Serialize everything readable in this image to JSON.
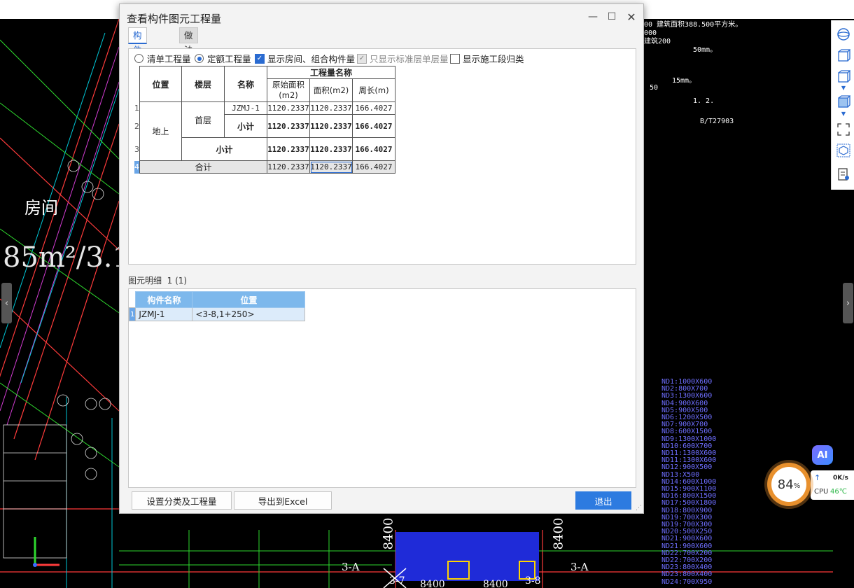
{
  "dialog": {
    "title": "查看构件图元工程量",
    "tabs": [
      {
        "label": "构件工程量",
        "active": true
      },
      {
        "label": "做法工程量",
        "active": false
      }
    ],
    "options": {
      "radio_list": "清单工程量",
      "radio_quota": "定额工程量",
      "radio_selected": "定额工程量",
      "show_rooms": {
        "label": "显示房间、组合构件量",
        "checked": true
      },
      "show_std_floor": {
        "label": "只显示标准层单层量",
        "checked": true,
        "disabled": true
      },
      "show_stage": {
        "label": "显示施工段归类",
        "checked": false
      }
    },
    "table": {
      "headers": {
        "position": "位置",
        "floor": "楼层",
        "name": "名称",
        "qty_group": "工程量名称",
        "orig_area": "原始面积(m2)",
        "area": "面积(m2)",
        "perimeter": "周长(m)"
      },
      "row_numbers": [
        "1",
        "2",
        "3",
        "4"
      ],
      "rows": {
        "position_value": "地上",
        "floor_value": "首层",
        "r1": {
          "name": "JZMJ-1",
          "orig_area": "1120.2337",
          "area": "1120.2337",
          "perimeter": "166.4027"
        },
        "r2": {
          "name": "小计",
          "orig_area": "1120.2337",
          "area": "1120.2337",
          "perimeter": "166.4027"
        },
        "r3": {
          "name": "小计",
          "orig_area": "1120.2337",
          "area": "1120.2337",
          "perimeter": "166.4027"
        },
        "r4": {
          "name": "合计",
          "orig_area": "1120.2337",
          "area": "1120.2337",
          "perimeter": "166.4027"
        }
      }
    },
    "detail": {
      "label": "图元明细",
      "count": "1 (1)",
      "headers": {
        "component": "构件名称",
        "position": "位置"
      },
      "rows": [
        {
          "n": "1",
          "component": "JZMJ-1",
          "position": "<3-8,1+250>"
        }
      ]
    },
    "buttons": {
      "classify": "设置分类及工程量",
      "export": "导出到Excel",
      "exit": "退出"
    }
  },
  "background": {
    "room_label": "房间",
    "area_text": "85m²/3.1",
    "dims": [
      "8400",
      "8400",
      "8400",
      "8400"
    ],
    "axis_labels": [
      "3-A",
      "3-A",
      "3-7",
      "3-8"
    ],
    "notes_top": "00 建筑面积388.500平方米。",
    "notes_2": "000",
    "notes_3": "建筑200",
    "notes_4": "50mm。",
    "notes_5": "15mm。",
    "notes_6": "50",
    "notes_7": "1. 2.",
    "notes_8": "B/T27903",
    "door_list": [
      "ND1:1000X600",
      "ND2:800X700",
      "ND3:1300X600",
      "ND4:900X600",
      "ND5:900X500",
      "ND6:1200X500",
      "ND7:900X700",
      "ND8:600X1500",
      "ND9:1300X1000",
      "ND10:600X700",
      "ND11:1300X600",
      "ND11:1300X600",
      "ND12:900X500",
      "ND13:X500",
      "ND14:600X1000",
      "ND15:900X1100",
      "ND16:800X1500",
      "ND17:500X1800",
      "ND18:800X900",
      "ND19:700X300",
      "ND19:700X300",
      "ND20:500X250",
      "ND21:900X600",
      "ND21:900X600",
      "ND22:700X200",
      "ND22:700X200",
      "ND23:800X400",
      "ND23:800X400",
      "ND24:700X950"
    ]
  },
  "right_toolbar": {
    "icons": [
      "globe-3d-icon",
      "view-3d-icon",
      "cube-outline-icon",
      "chevron-down-icon",
      "cube-solid-icon",
      "chevron-down-icon",
      "fullscreen-icon",
      "cube-select-icon",
      "document-eye-icon"
    ],
    "label_3d": "3D"
  },
  "widgets": {
    "ai_label": "AI",
    "cpu_percent": "84",
    "cpu_unit": "%",
    "net_speed": "0K/s",
    "cpu_label": "CPU",
    "cpu_temp": "46℃"
  }
}
